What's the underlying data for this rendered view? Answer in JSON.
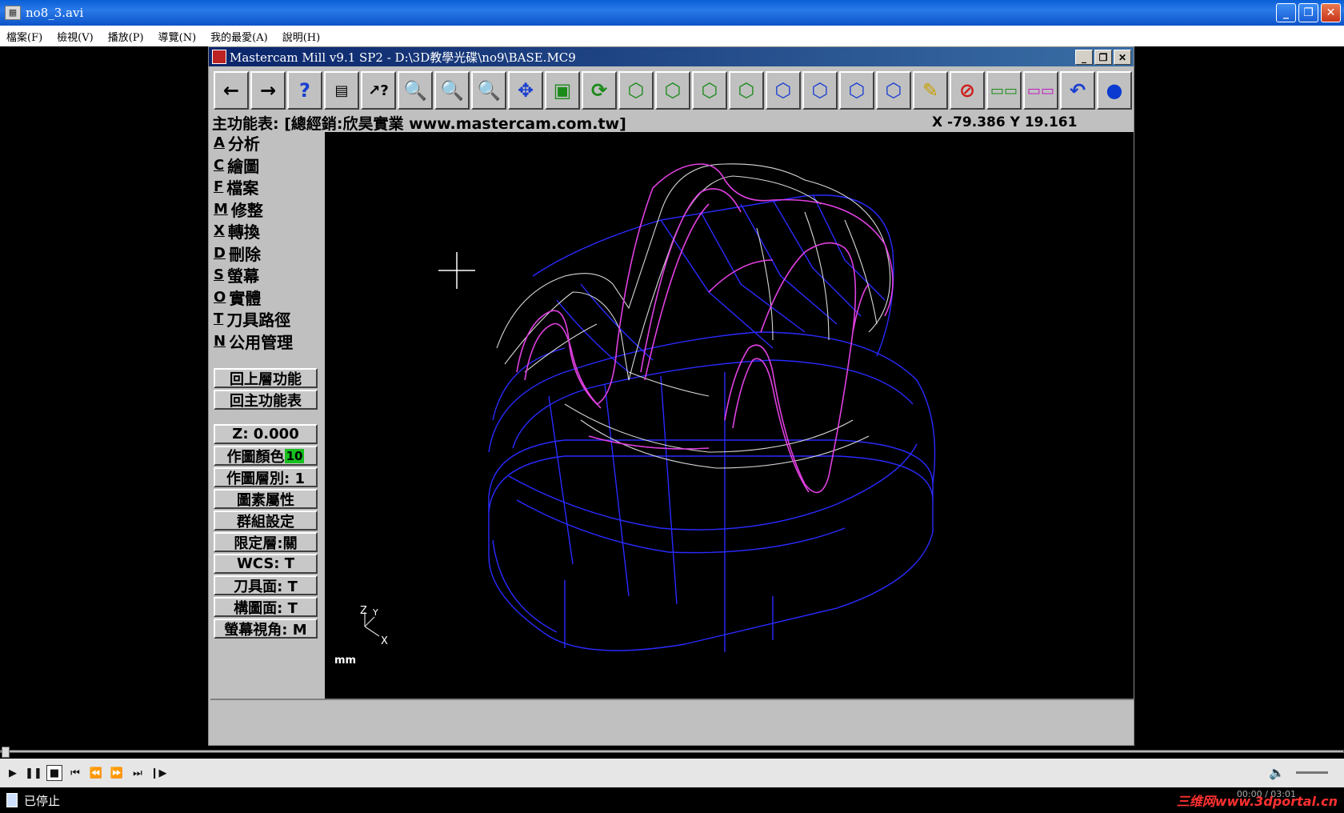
{
  "window": {
    "title": "no8_3.avi"
  },
  "menu": [
    "檔案(F)",
    "檢視(V)",
    "播放(P)",
    "導覽(N)",
    "我的最愛(A)",
    "說明(H)"
  ],
  "mastercam": {
    "title": "Mastercam Mill v9.1 SP2 - D:\\3D教學光碟\\no9\\BASE.MC9",
    "prompt": "主功能表: [總經銷:欣昊實業 www.mastercam.com.tw]",
    "coords": "X -79.386   Y 19.161",
    "menu_items": [
      {
        "key": "A",
        "label": "分析"
      },
      {
        "key": "C",
        "label": "繪圖"
      },
      {
        "key": "F",
        "label": "檔案"
      },
      {
        "key": "M",
        "label": "修整"
      },
      {
        "key": "X",
        "label": "轉換"
      },
      {
        "key": "D",
        "label": "刪除"
      },
      {
        "key": "S",
        "label": "螢幕"
      },
      {
        "key": "O",
        "label": "實體"
      },
      {
        "key": "T",
        "label": "刀具路徑"
      },
      {
        "key": "N",
        "label": "公用管理"
      }
    ],
    "nav": {
      "up": "回上層功能",
      "main": "回主功能表"
    },
    "settings": {
      "z": "Z:  0.000",
      "color_label": "作圖顏色",
      "color_value": "10",
      "level": "作圖層別: 1",
      "attrib": "圖素屬性",
      "group": "群組設定",
      "mask": "限定層:關",
      "wcs": "WCS:  T",
      "tplane": "刀具面: T",
      "cplane": "構圖面: T",
      "gview": "螢幕視角: M"
    },
    "units": "mm",
    "axis": {
      "z": "Z",
      "y": "Y",
      "x": "X"
    }
  },
  "player": {
    "status": "已停止",
    "watermark": "三维网www.3dportal.cn",
    "time": "00:00 / 03:01"
  },
  "colors": {
    "magenta": "#e040e0",
    "blue": "#2a2aff",
    "white": "#d8d8d8"
  }
}
